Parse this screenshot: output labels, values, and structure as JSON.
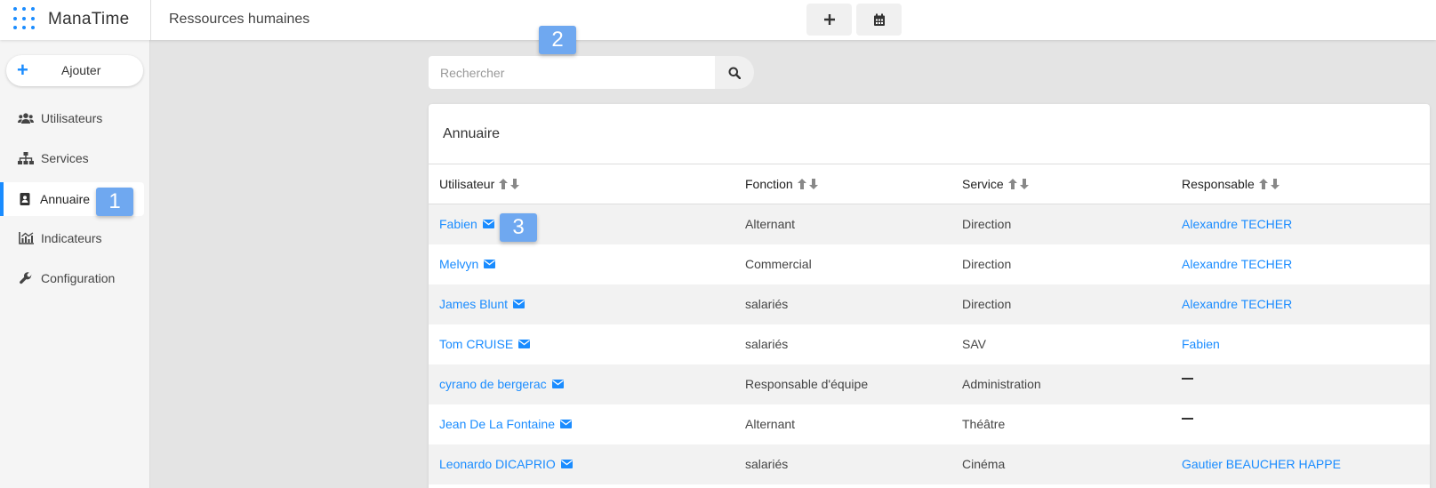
{
  "app": {
    "name": "ManaTime",
    "title": "Ressources humaines"
  },
  "sidebar": {
    "add_label": "Ajouter",
    "items": [
      {
        "label": "Utilisateurs",
        "icon": "users-icon"
      },
      {
        "label": "Services",
        "icon": "sitemap-icon"
      },
      {
        "label": "Annuaire",
        "icon": "address-book-icon",
        "active": true
      },
      {
        "label": "Indicateurs",
        "icon": "chart-icon"
      },
      {
        "label": "Configuration",
        "icon": "wrench-icon"
      }
    ]
  },
  "search": {
    "placeholder": "Rechercher"
  },
  "badges": [
    "1",
    "2",
    "3"
  ],
  "directory": {
    "title": "Annuaire",
    "columns": [
      "Utilisateur",
      "Fonction",
      "Service",
      "Responsable"
    ],
    "rows": [
      {
        "user": "Fabien",
        "function": "Alternant",
        "service": "Direction",
        "manager": "Alexandre TECHER"
      },
      {
        "user": "Melvyn",
        "function": "Commercial",
        "service": "Direction",
        "manager": "Alexandre TECHER"
      },
      {
        "user": "James Blunt",
        "function": "salariés",
        "service": "Direction",
        "manager": "Alexandre TECHER"
      },
      {
        "user": "Tom CRUISE",
        "function": "salariés",
        "service": "SAV",
        "manager": "Fabien"
      },
      {
        "user": "cyrano de bergerac",
        "function": "Responsable d'équipe",
        "service": "Administration",
        "manager": ""
      },
      {
        "user": "Jean De La Fontaine",
        "function": "Alternant",
        "service": "Théâtre",
        "manager": ""
      },
      {
        "user": "Leonardo DICAPRIO",
        "function": "salariés",
        "service": "Cinéma",
        "manager": "Gautier BEAUCHER HAPPE"
      }
    ]
  },
  "colors": {
    "accent": "#1a8cff",
    "badge": "#6fa8f0"
  }
}
